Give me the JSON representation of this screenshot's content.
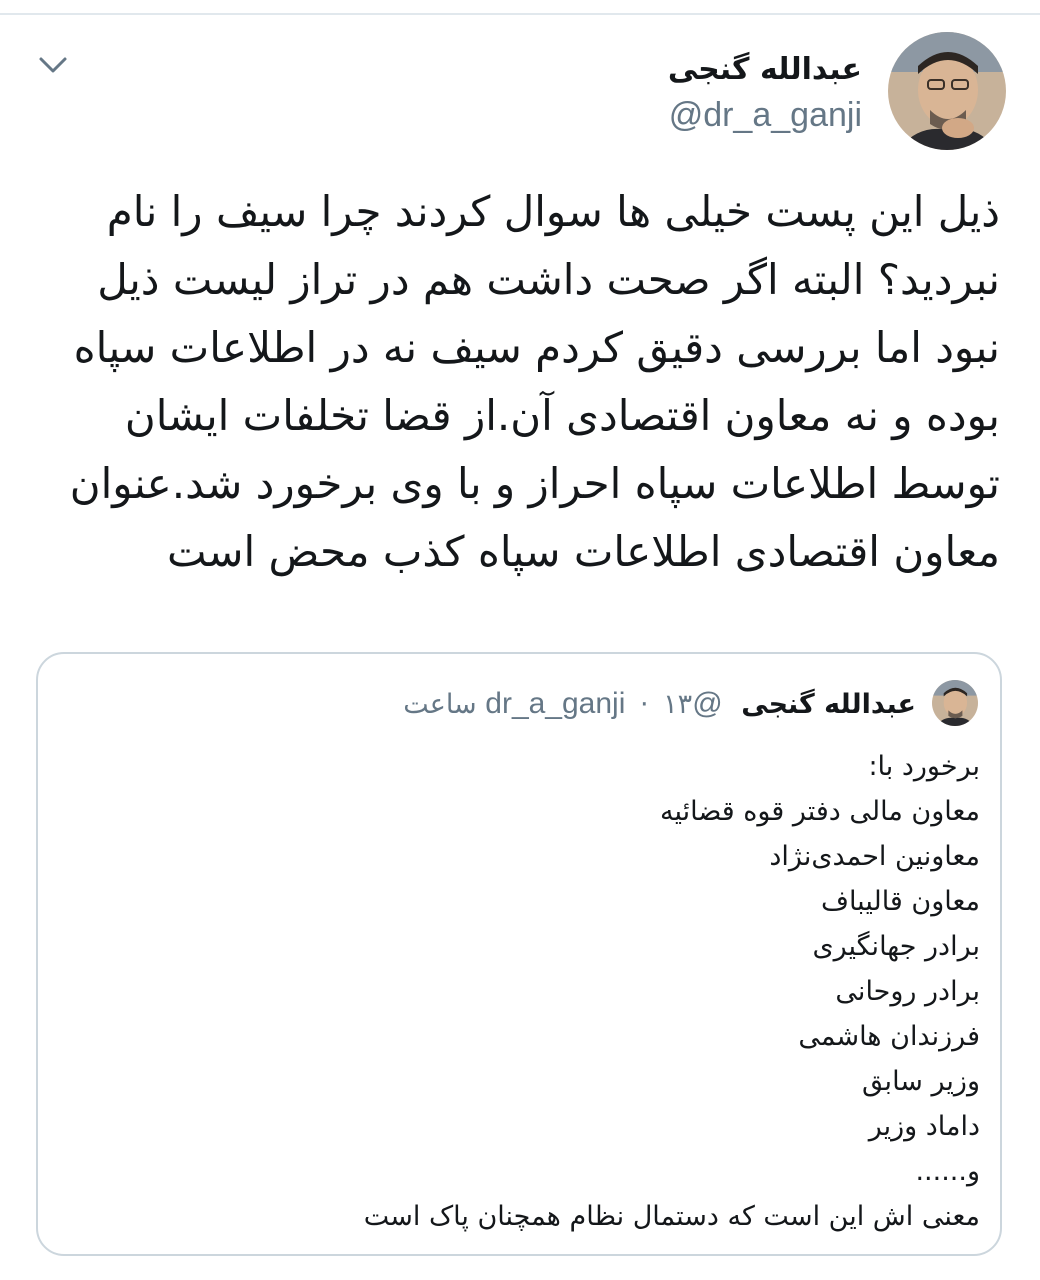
{
  "tweet": {
    "author_name": "عبدالله گنجی",
    "author_handle": "@dr_a_ganji",
    "avatar_icon": "avatar-photo",
    "menu_icon": "chevron-down-icon",
    "body_lines": [
      "ذیل این پست خیلی ها سوال کردند چرا سیف را نام",
      "نبردید؟ البته اگر صحت داشت هم در تراز لیست ذیل",
      "نبود اما بررسی دقیق کردم سیف نه در اطلاعات سپاه",
      "بوده و نه معاون اقتصادی آن.از قضا تخلفات ایشان",
      "توسط اطلاعات سپاه احراز و با وی برخورد شد.عنوان",
      "معاون اقتصادی اطلاعات سپاه کذب محض است"
    ]
  },
  "quoted_tweet": {
    "author_name": "عبدالله گنجی",
    "author_handle": "@dr_a_ganji",
    "separator": "·",
    "time": "۱۳ ساعت",
    "lines": [
      "برخورد با:",
      "معاون مالی دفتر قوه قضائیه",
      "معاونین احمدی‌نژاد",
      "معاون قالیباف",
      "برادر جهانگیری",
      "برادر روحانی",
      "فرزندان هاشمی",
      "وزیر سابق",
      "داماد وزیر",
      "و......",
      "معنی اش این است که دستمال نظام همچنان پاک است"
    ]
  },
  "colors": {
    "text": "#14171a",
    "secondary": "#657786",
    "border": "#ccd6dd",
    "divider": "#e1e8ed"
  }
}
